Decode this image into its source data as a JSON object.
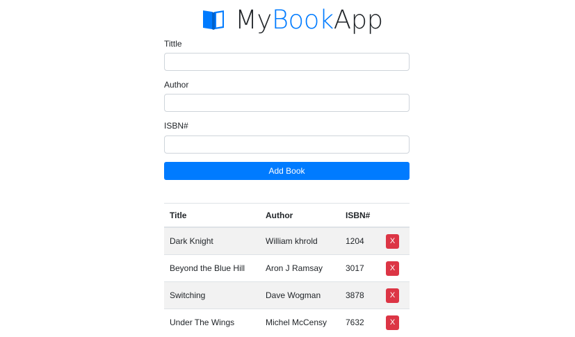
{
  "app": {
    "brand_prefix": "My",
    "brand_accent": "Book",
    "brand_suffix": "App",
    "brand_icon": "book-open-icon",
    "accent_color": "#007bff",
    "danger_color": "#dc3545"
  },
  "form": {
    "title_label": "Tittle",
    "title_value": "",
    "author_label": "Author",
    "author_value": "",
    "isbn_label": "ISBN#",
    "isbn_value": "",
    "submit_label": "Add Book"
  },
  "table": {
    "headers": [
      "Title",
      "Author",
      "ISBN#",
      ""
    ],
    "rows": [
      {
        "title": "Dark Knight",
        "author": "William khrold",
        "isbn": "1204",
        "delete_label": "X"
      },
      {
        "title": "Beyond the Blue Hill",
        "author": "Aron J Ramsay",
        "isbn": "3017",
        "delete_label": "X"
      },
      {
        "title": "Switching",
        "author": "Dave Wogman",
        "isbn": "3878",
        "delete_label": "X"
      },
      {
        "title": "Under The Wings",
        "author": "Michel McCensy",
        "isbn": "7632",
        "delete_label": "X"
      }
    ]
  }
}
